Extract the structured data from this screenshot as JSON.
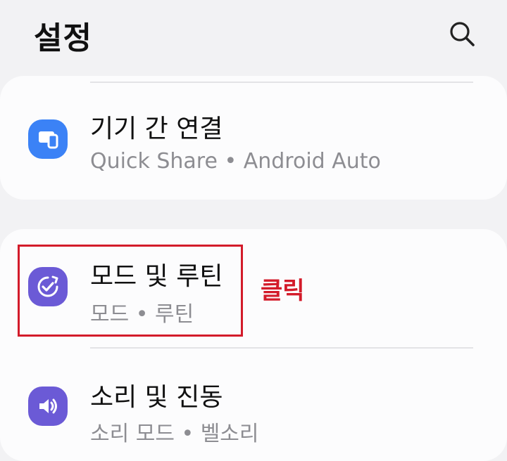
{
  "header": {
    "title": "설정",
    "search_icon": "search-icon"
  },
  "items": [
    {
      "title": "기기 간 연결",
      "subtitle": "Quick Share • Android Auto",
      "icon": "devices-icon",
      "icon_color": "#3b82f6"
    },
    {
      "title": "모드 및 루틴",
      "subtitle": "모드 • 루틴",
      "icon": "modes-routines-icon",
      "icon_color": "#6b5ad6"
    },
    {
      "title": "소리 및 진동",
      "subtitle": "소리 모드 • 벨소리",
      "icon": "sound-icon",
      "icon_color": "#6b5ad6"
    }
  ],
  "annotation": {
    "label": "클릭",
    "color": "#d31b2a"
  }
}
